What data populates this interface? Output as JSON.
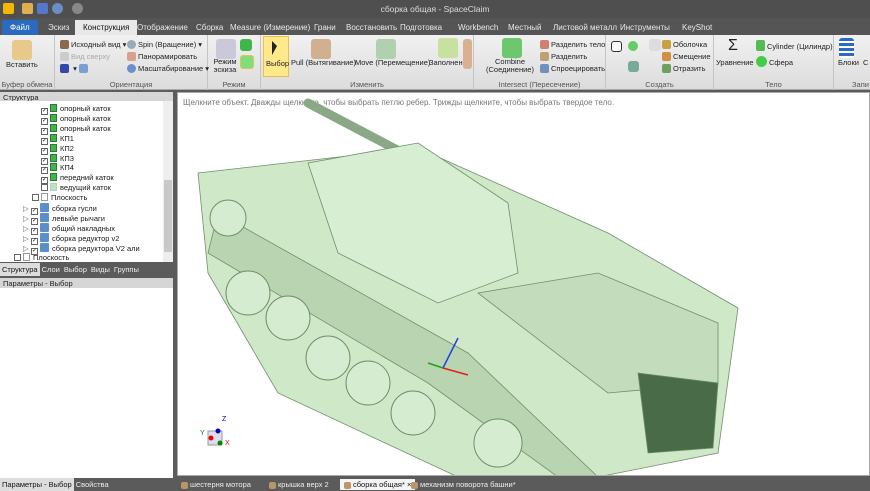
{
  "window": {
    "title": "сборка общая - SpaceClaim"
  },
  "tabs": [
    "Файл",
    "Эскиз",
    "Конструкция",
    "Отображение",
    "Сборка",
    "Measure (Измерение)",
    "Грани",
    "Восстановить",
    "Подготовка",
    "Workbench",
    "Местный",
    "Листовой металл",
    "Инструменты",
    "KeyShot"
  ],
  "ribbon": {
    "clipboard": {
      "paste": "Вставить",
      "label": "Буфер обмена"
    },
    "orientation": {
      "home": "Исходный вид",
      "top": "Вид сверху",
      "spin": "Spin (Вращение)",
      "pan": "Панорамировать",
      "zoom": "Масштабирование",
      "label": "Ориентация"
    },
    "mode": {
      "sketch": "Режим эскиза",
      "label": "Режим"
    },
    "edit": {
      "select": "Выбор",
      "pull": "Pull (Вытягивание)",
      "move": "Move (Перемещение)",
      "fill": "Заполнение",
      "label": "Изменить"
    },
    "intersect": {
      "combine": "Combine (Соединение)",
      "split_body": "Разделить тело",
      "split": "Разделить",
      "project": "Спроецировать",
      "label": "Intersect (Пересечение)"
    },
    "create": {
      "shell": "Оболочка",
      "offset": "Смещение",
      "mirror": "Отразить",
      "label": "Создать"
    },
    "body": {
      "equation": "Уравнение",
      "cylinder": "Cylinder (Цилиндр)",
      "sphere": "Сфера",
      "label": "Тело"
    },
    "blocks": {
      "blocks": "Блоки",
      "more": "С",
      "label": "Запи"
    }
  },
  "structure": {
    "title": "Структура",
    "items": [
      {
        "label": "опорный каток",
        "level": 3,
        "checked": true,
        "type": "part"
      },
      {
        "label": "опорный каток",
        "level": 3,
        "checked": true,
        "type": "part"
      },
      {
        "label": "опорный каток",
        "level": 3,
        "checked": true,
        "type": "part"
      },
      {
        "label": "КП1",
        "level": 3,
        "checked": true,
        "type": "part"
      },
      {
        "label": "КП2",
        "level": 3,
        "checked": true,
        "type": "part"
      },
      {
        "label": "КП3",
        "level": 3,
        "checked": true,
        "type": "part"
      },
      {
        "label": "КП4",
        "level": 3,
        "checked": true,
        "type": "part"
      },
      {
        "label": "передний каток",
        "level": 3,
        "checked": true,
        "type": "part"
      },
      {
        "label": "ведущий каток",
        "level": 3,
        "checked": false,
        "type": "part"
      },
      {
        "label": "Плоскость",
        "level": 2,
        "checked": false,
        "type": "plane"
      },
      {
        "label": "сборка гусли",
        "level": 1,
        "checked": true,
        "type": "asm"
      },
      {
        "label": "левыйе рычаги",
        "level": 1,
        "checked": true,
        "type": "asm"
      },
      {
        "label": "общий накладных",
        "level": 1,
        "checked": true,
        "type": "asm"
      },
      {
        "label": "сборка редуктор v2",
        "level": 1,
        "checked": true,
        "type": "asm"
      },
      {
        "label": "сборка редуктора V2 али",
        "level": 1,
        "checked": true,
        "type": "asm"
      },
      {
        "label": "Плоскость",
        "level": 0,
        "checked": false,
        "type": "plane"
      }
    ],
    "tabs": [
      "Структура",
      "Слои",
      "Выбор",
      "Виды",
      "Группы"
    ]
  },
  "params": {
    "title": "Параметры - Выбор",
    "tabs": [
      "Параметры - Выбор",
      "Свойства"
    ]
  },
  "viewport": {
    "hint": "Щелкните объект. Дважды щелкните, чтобы выбрать петлю ребер. Трижды щелкните, чтобы выбрать твердое тело.",
    "axes": {
      "x": "X",
      "y": "Y",
      "z": "Z"
    },
    "model_color": "#cfe8c8"
  },
  "doc_tabs": [
    {
      "label": "шестерня мотора",
      "active": false
    },
    {
      "label": "крышка верх 2",
      "active": false
    },
    {
      "label": "сборка общая*",
      "active": true
    },
    {
      "label": "механизм поворота башни*",
      "active": false
    }
  ]
}
